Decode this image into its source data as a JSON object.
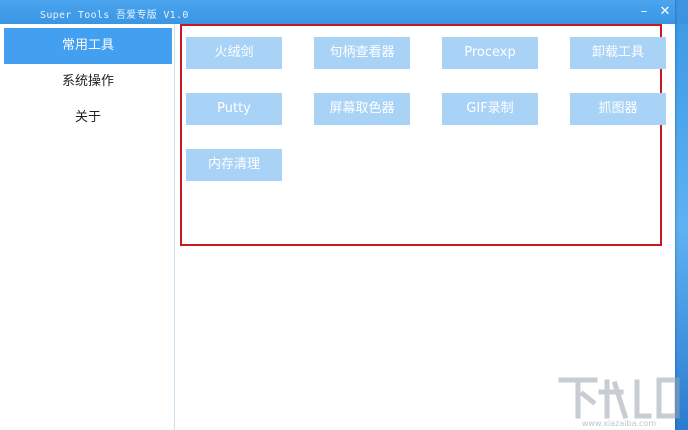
{
  "window": {
    "title": "Super Tools 吾爱专版 V1.0",
    "minimize_glyph": "–",
    "close_glyph": "✕"
  },
  "sidebar": {
    "items": [
      {
        "label": "常用工具",
        "active": true
      },
      {
        "label": "系统操作",
        "active": false
      },
      {
        "label": "关于",
        "active": false
      }
    ]
  },
  "tools": {
    "buttons": [
      {
        "label": "火绒剑"
      },
      {
        "label": "句柄查看器"
      },
      {
        "label": "Procexp"
      },
      {
        "label": "卸载工具"
      },
      {
        "label": "Putty"
      },
      {
        "label": "屏幕取色器"
      },
      {
        "label": "GIF录制"
      },
      {
        "label": "抓图器"
      },
      {
        "label": "内存清理"
      }
    ]
  },
  "watermark": {
    "url": "www.xiazaiba.com"
  },
  "colors": {
    "accent": "#43a0f0",
    "tool_button": "#a9d2f7",
    "highlight_border": "#c8191d",
    "titlebar": "#3a96e4"
  }
}
